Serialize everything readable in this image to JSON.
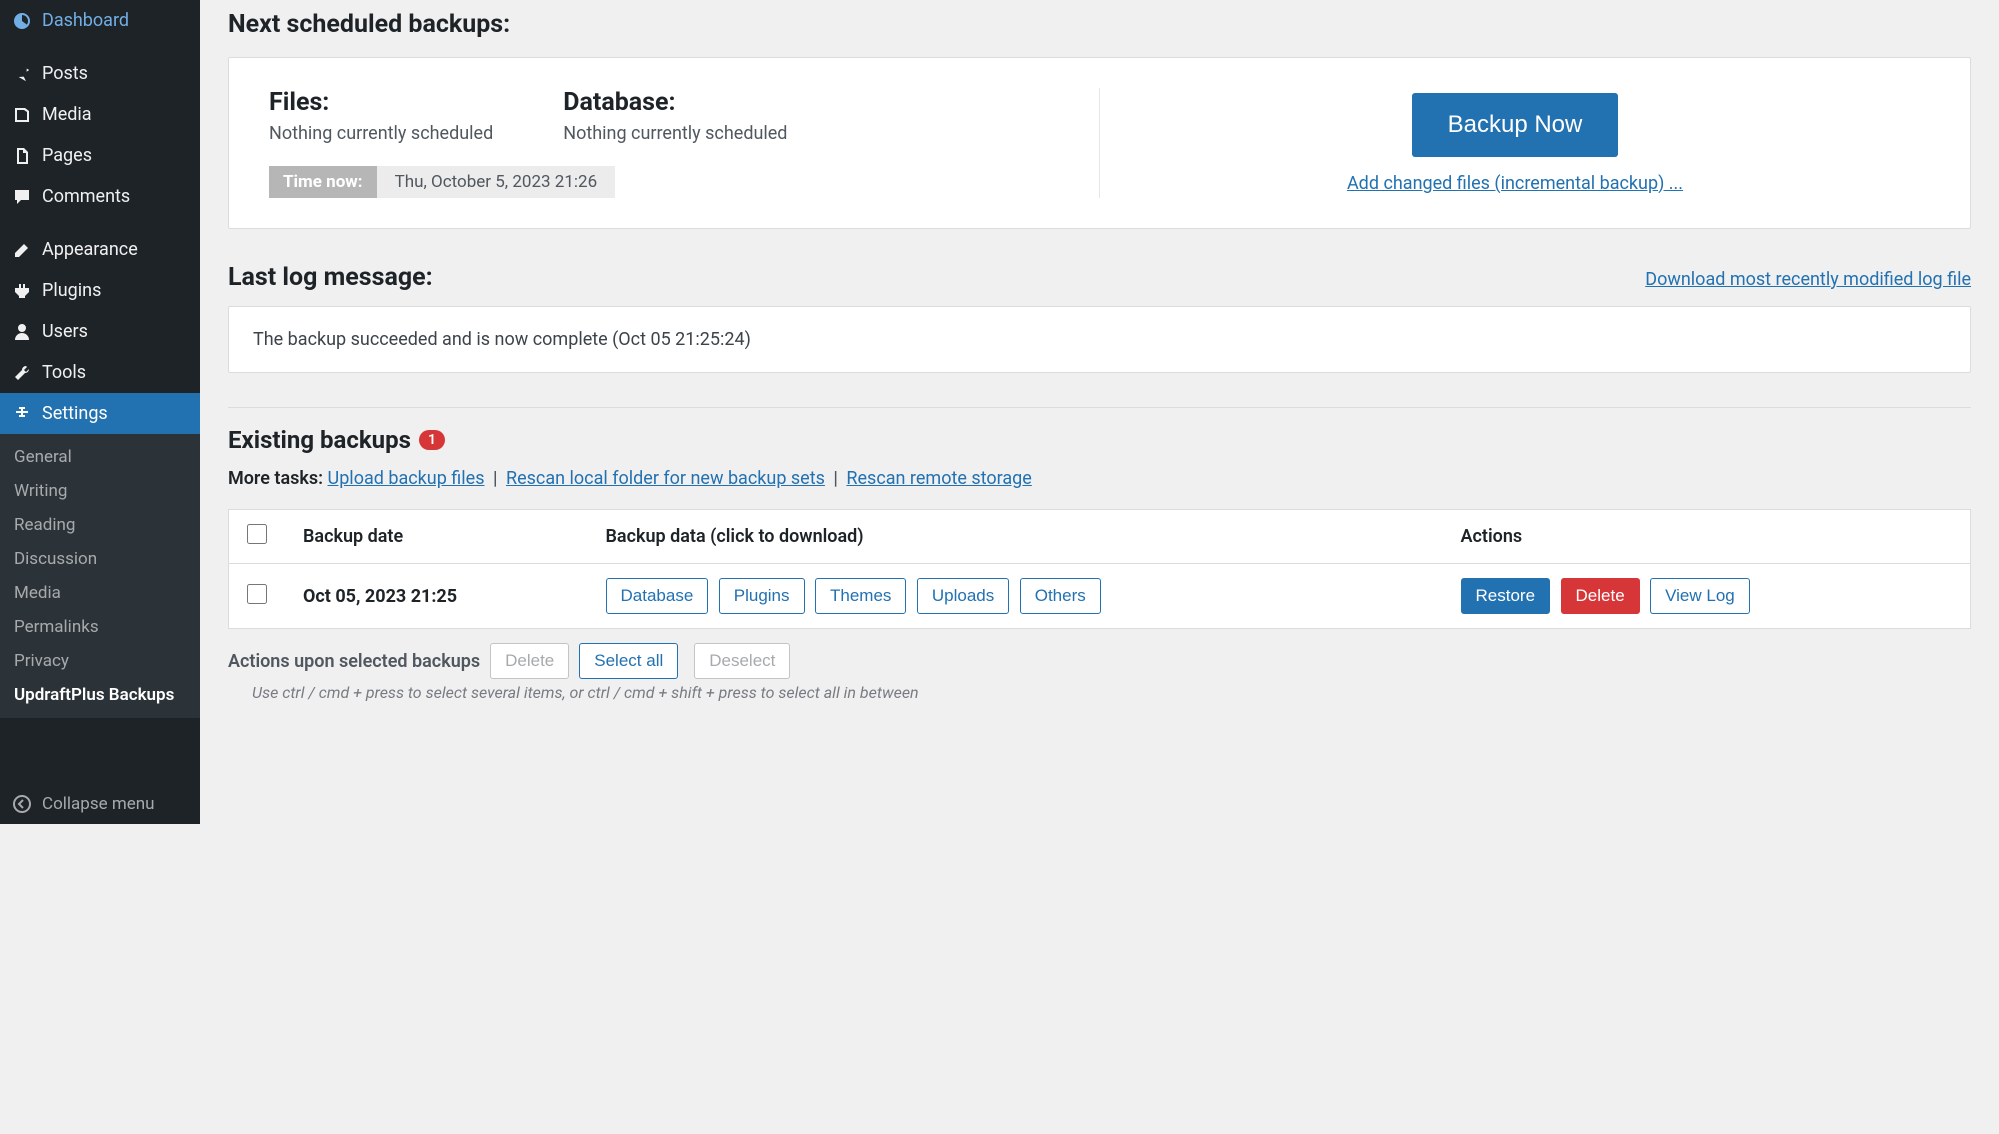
{
  "sidebar": {
    "dashboard": "Dashboard",
    "posts": "Posts",
    "media": "Media",
    "pages": "Pages",
    "comments": "Comments",
    "appearance": "Appearance",
    "plugins": "Plugins",
    "users": "Users",
    "tools": "Tools",
    "settings": "Settings",
    "submenu": {
      "general": "General",
      "writing": "Writing",
      "reading": "Reading",
      "discussion": "Discussion",
      "media": "Media",
      "permalinks": "Permalinks",
      "privacy": "Privacy",
      "updraftplus": "UpdraftPlus Backups"
    },
    "collapse": "Collapse menu"
  },
  "schedule": {
    "heading": "Next scheduled backups:",
    "files_label": "Files:",
    "files_value": "Nothing currently scheduled",
    "database_label": "Database:",
    "database_value": "Nothing currently scheduled",
    "time_now_label": "Time now:",
    "time_now_value": "Thu, October 5, 2023 21:26",
    "backup_now_button": "Backup Now",
    "incremental_link": "Add changed files (incremental backup) ..."
  },
  "log": {
    "heading": "Last log message:",
    "download_link": "Download most recently modified log file",
    "message": "The backup succeeded and is now complete (Oct 05 21:25:24)"
  },
  "existing": {
    "heading": "Existing backups",
    "count": "1",
    "more_tasks_label": "More tasks:",
    "upload": "Upload backup files",
    "rescan_local": "Rescan local folder for new backup sets",
    "rescan_remote": "Rescan remote storage",
    "columns": {
      "date": "Backup date",
      "data": "Backup data (click to download)",
      "actions": "Actions"
    },
    "rows": [
      {
        "date": "Oct 05, 2023 21:25",
        "buttons": {
          "database": "Database",
          "plugins": "Plugins",
          "themes": "Themes",
          "uploads": "Uploads",
          "others": "Others"
        },
        "actions": {
          "restore": "Restore",
          "delete": "Delete",
          "viewlog": "View Log"
        }
      }
    ],
    "selected_label": "Actions upon selected backups",
    "delete_btn": "Delete",
    "select_all_btn": "Select all",
    "deselect_btn": "Deselect",
    "hint": "Use ctrl / cmd + press to select several items, or ctrl / cmd + shift + press to select all in between"
  }
}
